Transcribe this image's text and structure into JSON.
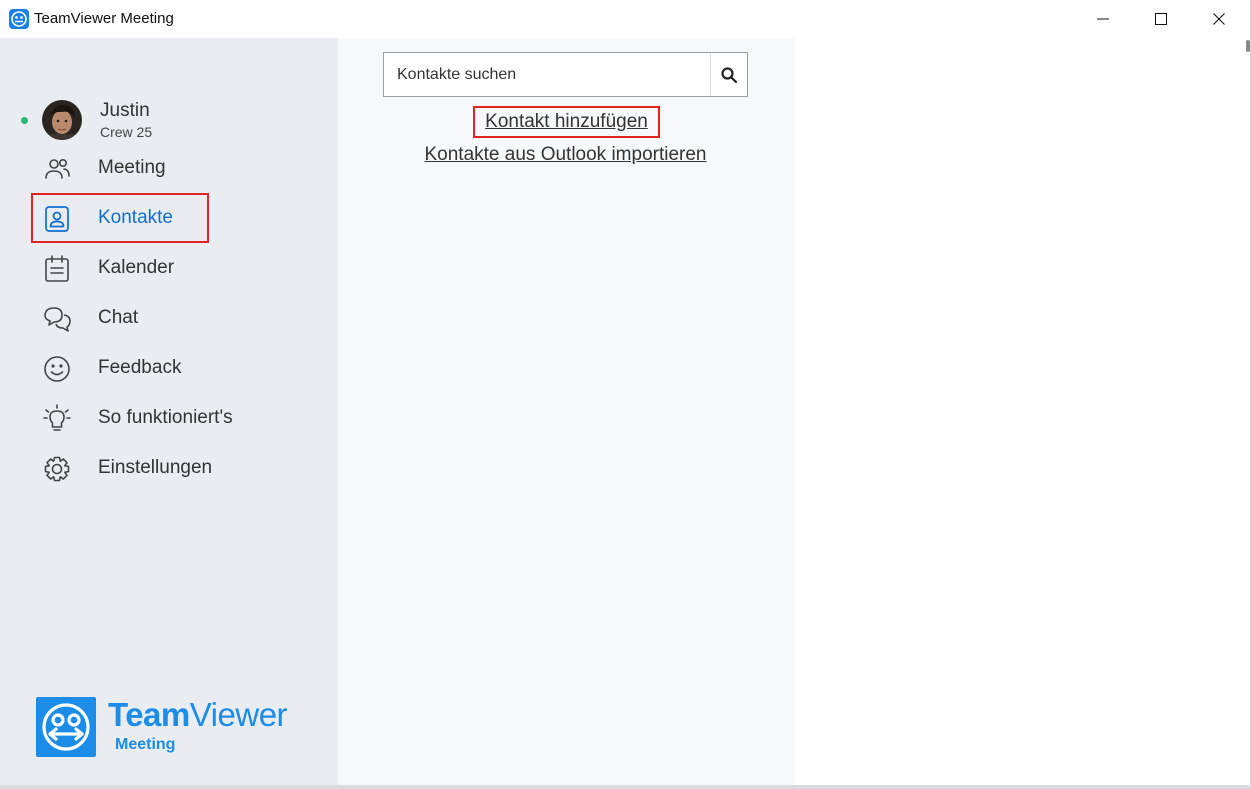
{
  "window": {
    "title": "TeamViewer Meeting"
  },
  "profile": {
    "name": "Justin",
    "subtitle": "Crew 25",
    "status_color": "#2cb673"
  },
  "sidebar": {
    "items": [
      {
        "label": "Meeting",
        "icon": "people-icon",
        "active": false
      },
      {
        "label": "Kontakte",
        "icon": "contact-card-icon",
        "active": true
      },
      {
        "label": "Kalender",
        "icon": "calendar-icon",
        "active": false
      },
      {
        "label": "Chat",
        "icon": "chat-bubbles-icon",
        "active": false
      },
      {
        "label": "Feedback",
        "icon": "smiley-icon",
        "active": false
      },
      {
        "label": "So funktioniert's",
        "icon": "lightbulb-icon",
        "active": false
      },
      {
        "label": "Einstellungen",
        "icon": "gear-icon",
        "active": false
      }
    ]
  },
  "logo": {
    "word_bold": "Team",
    "word_regular": "Viewer",
    "sub": "Meeting"
  },
  "contacts": {
    "search_placeholder": "Kontakte suchen",
    "add_contact": "Kontakt hinzufügen",
    "import_outlook": "Kontakte aus Outlook importieren"
  },
  "colors": {
    "accent": "#0e6fd1",
    "brand": "#1b8ce8",
    "highlight": "#e02424",
    "sidebar_bg": "#e9ecf0"
  }
}
